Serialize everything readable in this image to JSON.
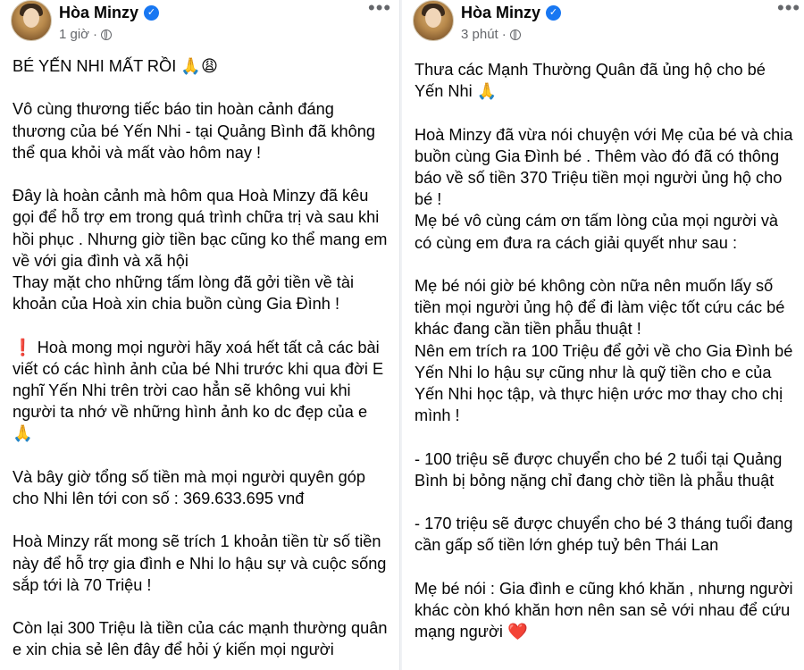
{
  "left_post": {
    "author": "Hòa Minzy",
    "time": "1 giờ",
    "more": "•••",
    "body": "BÉ YẾN NHI MẤT RỒI 🙏😩\n\nVô cùng thương tiếc báo tin hoàn cảnh đáng thương của bé Yến Nhi - tại Quảng Bình đã không thể qua khỏi và mất vào hôm nay !\n\nĐây là hoàn cảnh mà hôm qua Hoà Minzy đã kêu gọi để hỗ trợ em trong quá trình chữa trị và sau khi hồi phục . Nhưng giờ tiền bạc cũng ko thể mang em về với gia đình và xã hội\nThay mặt cho những tấm lòng đã gởi tiền về tài khoản của Hoà xin chia buồn cùng Gia Đình !\n\n❗ Hoà mong mọi người hãy xoá hết tất cả các bài viết có các hình ảnh của bé Nhi trước khi qua đời E nghĩ Yến Nhi trên trời cao hẳn sẽ không vui khi người ta nhớ về những hình ảnh ko dc đẹp của e 🙏\n\nVà bây giờ tổng số tiền mà mọi người quyên góp cho Nhi lên tới con số : 369.633.695 vnđ\n\nHoà Minzy rất mong sẽ trích 1 khoản tiền từ số tiền này để hỗ trợ gia đình e Nhi lo hậu sự và cuộc sống sắp tới là 70 Triệu !\n\nCòn lại 300 Triệu là tiền của các mạnh thường quân e xin chia sẻ lên đây để hỏi ý kiến mọi người"
  },
  "right_post": {
    "author": "Hòa Minzy",
    "time": "3 phút",
    "more": "•••",
    "body": "Thưa các Mạnh Thường Quân đã ủng hộ cho bé Yến Nhi 🙏\n\nHoà Minzy đã vừa nói chuyện với Mẹ của bé và chia buồn cùng Gia Đình bé . Thêm vào đó đã có thông báo về số tiền 370 Triệu tiền mọi người ủng hộ cho bé !\nMẹ bé vô cùng cám ơn tấm lòng của mọi người và có cùng em đưa ra cách giải quyết như sau :\n\nMẹ bé nói giờ bé không còn nữa nên muốn lấy số tiền mọi người ủng hộ để đi làm việc tốt cứu các bé khác đang cần tiền phẫu thuật !\nNên em trích ra 100 Triệu để gởi về cho Gia Đình bé Yến Nhi lo hậu sự cũng như là quỹ tiền cho e của Yến Nhi học tập, và thực hiện ước mơ thay cho chị mình !\n\n- 100 triệu sẽ được chuyển cho bé 2 tuổi tại Quảng Bình bị bỏng nặng chỉ đang chờ tiền là phẫu thuật\n\n- 170 triệu sẽ được chuyển cho bé 3 tháng tuổi đang cần gấp số tiền lớn ghép tuỷ bên Thái Lan\n\nMẹ bé nói : Gia đình e cũng khó khăn , nhưng người khác còn khó khăn hơn nên san sẻ với nhau để cứu mạng người ❤️"
  }
}
